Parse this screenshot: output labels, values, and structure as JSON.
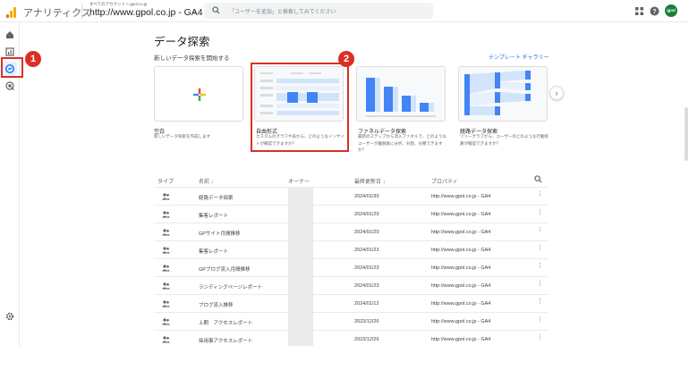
{
  "topbar": {
    "app_name": "アナリティクス",
    "account_crumb": "すべてのアカウント > gpol.co.jp",
    "property_name": "http://www.gpol.co.jp - GA4",
    "property_caret": "▾",
    "search_placeholder": "「ユーザーを追加」と検索してみてください",
    "avatar_label": "gpol"
  },
  "annotations": {
    "badge1": "1",
    "badge2": "2",
    "highlight_color": "#d93025"
  },
  "main": {
    "title": "データ探索",
    "section_label": "新しいデータ探索を開始する",
    "gallery_link": "テンプレート ギャラリー",
    "next_arrow": "›",
    "cards": [
      {
        "title": "空白",
        "desc": "新しいデータ探索を作成します"
      },
      {
        "title": "自由形式",
        "desc": "カスタムのグラフや表から、どのようなインサイトが確認できますか？"
      },
      {
        "title": "ファネルデータ探索",
        "desc": "最新のステップから流入ファネルで、どのようなユーザーが離脱後に分析、分割、分類できますか？"
      },
      {
        "title": "経路データ探索",
        "desc": "ツリーグラフから、ユーザーのどのような行動経路が確認できますか？"
      }
    ]
  },
  "table": {
    "headers": {
      "type": "タイプ",
      "name": "名前 ↓",
      "owner": "オーナー",
      "modified": "最終更新日 ↓",
      "property": "プロパティ"
    },
    "rows": [
      {
        "name": "経路データ探索",
        "date": "2024/01/30",
        "property": "http://www.gpol.co.jp - GA4"
      },
      {
        "name": "集客レポート",
        "date": "2024/01/29",
        "property": "http://www.gpol.co.jp - GA4"
      },
      {
        "name": "GPサイト月間推移",
        "date": "2024/01/29",
        "property": "http://www.gpol.co.jp - GA4"
      },
      {
        "name": "集客レポート",
        "date": "2024/01/23",
        "property": "http://www.gpol.co.jp - GA4"
      },
      {
        "name": "GPブログ流入月間推移",
        "date": "2024/01/23",
        "property": "http://www.gpol.co.jp - GA4"
      },
      {
        "name": "ランディングページレポート",
        "date": "2024/01/23",
        "property": "http://www.gpol.co.jp - GA4"
      },
      {
        "name": "ブログ流入推移",
        "date": "2024/01/12",
        "property": "http://www.gpol.co.jp - GA4"
      },
      {
        "name": "上期　アクセスレポート",
        "date": "2023/12/26",
        "property": "http://www.gpol.co.jp - GA4"
      },
      {
        "name": "採用事アクセスレポート",
        "date": "2023/12/26",
        "property": "http://www.gpol.co.jp - GA4"
      }
    ],
    "more_glyph": "⋮"
  },
  "icons": {
    "logo": "analytics-logo-icon",
    "search": "search-icon",
    "apps": "apps-grid-icon",
    "help": "help-icon",
    "home": "home-icon",
    "reports": "reports-icon",
    "explore": "explore-icon",
    "advertising": "advertising-icon",
    "admin": "gear-icon"
  }
}
